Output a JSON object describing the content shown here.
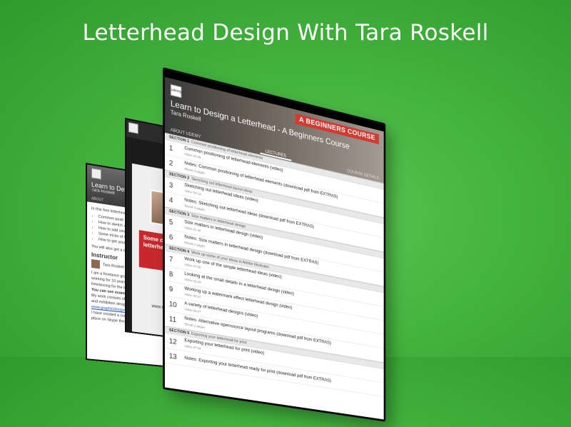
{
  "headline": "Letterhead Design With Tara Roskell",
  "colors": {
    "background": "#43b43d",
    "banner_red": "#d23b32",
    "link_blue": "#1a4fb8"
  },
  "back_tablet": {
    "title": "Learn to Desig",
    "author": "Tara Roskell",
    "tab": "ABOUT",
    "intro": "In this free letterhead d",
    "bullets": [
      "Common posit",
      "How to sketch ou",
      "How to add smal",
      "Some tricks of th",
      "How to get your l"
    ],
    "also": "You will also get a dow",
    "instructor_label": "Instructor",
    "instructor_name": "Tara Roskell",
    "bio_1": "I am a freelance graphi",
    "bio_2": "working for 10 years full",
    "bio_3": "freelancing for the last 6",
    "examples": "You can see examples o",
    "work_1": "My work consists of ma",
    "work_2": "and exhibition design. I",
    "link": "www.graphicdesignbloc",
    "course_1": "I have created a course",
    "course_2": "place on Skype through"
  },
  "mid_tablet": {
    "red_card": "Some comm positioning letterhead",
    "url": "www.nobulldesign"
  },
  "front_tablet": {
    "logo_label": "udemy",
    "banner": "A BEGINNERS COURSE",
    "course_title": "Learn to Design a Letterhead - A Beginners Course",
    "author": "Tara Roskell",
    "tabs": {
      "about": "ABOUT UDEMY",
      "lectures": "LECTURES",
      "details": "COURSE DETAILS"
    },
    "items": [
      {
        "kind": "section",
        "num": "SECTION 1",
        "title": "Common positioning of letterhead elements"
      },
      {
        "kind": "lecture",
        "num": "1",
        "title": "Common positioning of letterhead elements (video)",
        "meta": "Video 03:45"
      },
      {
        "kind": "lecture",
        "num": "2",
        "title": "Notes: Common positioning of letterhead elements (download pdf from EXTRAS)",
        "meta": "Ebook 3 pages"
      },
      {
        "kind": "section",
        "num": "SECTION 2",
        "title": "Sketching out letterhead layout ideas"
      },
      {
        "kind": "lecture",
        "num": "3",
        "title": "Sketching out letterhead ideas (video)",
        "meta": "Video 04:13"
      },
      {
        "kind": "lecture",
        "num": "4",
        "title": "Notes: Sketching out letterhead ideas (download pdf from EXTRAS)",
        "meta": "Ebook 3 pages"
      },
      {
        "kind": "section",
        "num": "SECTION 3",
        "title": "Size matters in letterhead design"
      },
      {
        "kind": "lecture",
        "num": "5",
        "title": "Size matters in letterhead design (video)",
        "meta": "Video 01:40"
      },
      {
        "kind": "lecture",
        "num": "6",
        "title": "Notes: Size matters in letterhead design (download pdf from EXTRAS)",
        "meta": "Ebook 2 pages"
      },
      {
        "kind": "section",
        "num": "SECTION 4",
        "title": "Work up some of your ideas in Adobe Illustrator"
      },
      {
        "kind": "lecture",
        "num": "7",
        "title": "Work up one of the simple letterhead ideas (video)",
        "meta": "Video 07:58"
      },
      {
        "kind": "lecture",
        "num": "8",
        "title": "Looking at the small details in a letterhead design (video)",
        "meta": "Video 02:34"
      },
      {
        "kind": "lecture",
        "num": "9",
        "title": "Working up a watermark effect letterhead design (video)",
        "meta": "Video 06:37"
      },
      {
        "kind": "lecture",
        "num": "10",
        "title": "A variety of letterhead designs (video)",
        "meta": "Video 00:47"
      },
      {
        "kind": "lecture",
        "num": "11",
        "title": "Notes: Alternative opensource layout programs (download pdf from EXTRAS)",
        "meta": "Ebook 1 pages"
      },
      {
        "kind": "section",
        "num": "SECTION 5",
        "title": "Exporting your letterhead for print"
      },
      {
        "kind": "lecture",
        "num": "12",
        "title": "Exporting your letterhead for print (video)",
        "meta": "Video 07:34"
      },
      {
        "kind": "lecture",
        "num": "13",
        "title": "Notes: Exporting your letterhead ready for print (download pdf from EXTRAS)",
        "meta": ""
      }
    ]
  }
}
